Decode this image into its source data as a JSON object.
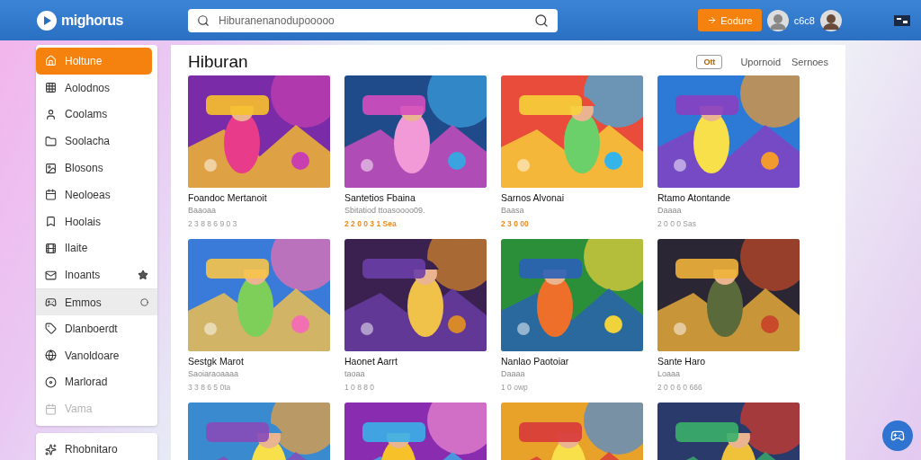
{
  "header": {
    "brand": "mighorus",
    "search": {
      "placeholder": "Hiburanenanodupooooo"
    },
    "action_button": "Eodure",
    "user_label": "c6c8"
  },
  "sidebar": {
    "items": [
      {
        "label": "Holtune",
        "selected": true,
        "focused": false,
        "disabled": false
      },
      {
        "label": "Aolodnos",
        "selected": false,
        "focused": false,
        "disabled": false
      },
      {
        "label": "Coolams",
        "selected": false,
        "focused": false,
        "disabled": false
      },
      {
        "label": "Soolacha",
        "selected": false,
        "focused": false,
        "disabled": false
      },
      {
        "label": "Blosons",
        "selected": false,
        "focused": false,
        "disabled": false
      },
      {
        "label": "Neoloeas",
        "selected": false,
        "focused": false,
        "disabled": false
      },
      {
        "label": "Hoolais",
        "selected": false,
        "focused": false,
        "disabled": false
      },
      {
        "label": "Ilaite",
        "selected": false,
        "focused": false,
        "disabled": false
      },
      {
        "label": "Inoants",
        "selected": false,
        "focused": false,
        "disabled": false
      },
      {
        "label": "Emmos",
        "selected": false,
        "focused": true,
        "disabled": false
      },
      {
        "label": "Dlanboerdt",
        "selected": false,
        "focused": false,
        "disabled": false
      },
      {
        "label": "Vanoldoare",
        "selected": false,
        "focused": false,
        "disabled": false
      },
      {
        "label": "Marlorad",
        "selected": false,
        "focused": false,
        "disabled": false
      },
      {
        "label": "Vama",
        "selected": false,
        "focused": false,
        "disabled": true
      }
    ],
    "footer_item": "Rhobnitaro"
  },
  "section": {
    "title": "Hiburan",
    "chip": "Ott",
    "links": [
      "Upornoid",
      "Sernoes"
    ]
  },
  "cards": [
    {
      "kind": "game",
      "title": "Foandoc Mertanoit",
      "subtitle": "Baaoaa",
      "meta": "2 3 8 8 6 9 0 3",
      "highlight": false
    },
    {
      "kind": "game",
      "title": "Santetios Fbaina",
      "subtitle": "Sbitatiod ttoasoooo09.",
      "meta": "2 2 0 0 3 1 Sea",
      "highlight": true
    },
    {
      "kind": "game",
      "title": "Sarnos Alvonai",
      "subtitle": "Baasa",
      "meta": "2 3 0 00",
      "highlight": true
    },
    {
      "kind": "game",
      "title": "Rtamo Atontande",
      "subtitle": "Daaaa",
      "meta": "2 0 0 0 Sas",
      "highlight": false
    },
    {
      "kind": "game",
      "title": "Sestgk Marot",
      "subtitle": "Saoiaraoaaaa",
      "meta": "3 3 8 6 5 0ta",
      "highlight": false
    },
    {
      "kind": "game",
      "title": "Haonet Aarrt",
      "subtitle": "taoaa",
      "meta": "1 0 8 8 0",
      "highlight": false
    },
    {
      "kind": "game",
      "title": "Nanlao Paotoiar",
      "subtitle": "Daaaa",
      "meta": "1 0 owp",
      "highlight": false
    },
    {
      "kind": "game",
      "title": "Sante Haro",
      "subtitle": "Loaaa",
      "meta": "2 0 0 6 0 666",
      "highlight": false
    },
    {
      "kind": "picture"
    },
    {
      "kind": "picture"
    },
    {
      "kind": "picture"
    },
    {
      "kind": "picture"
    }
  ]
}
